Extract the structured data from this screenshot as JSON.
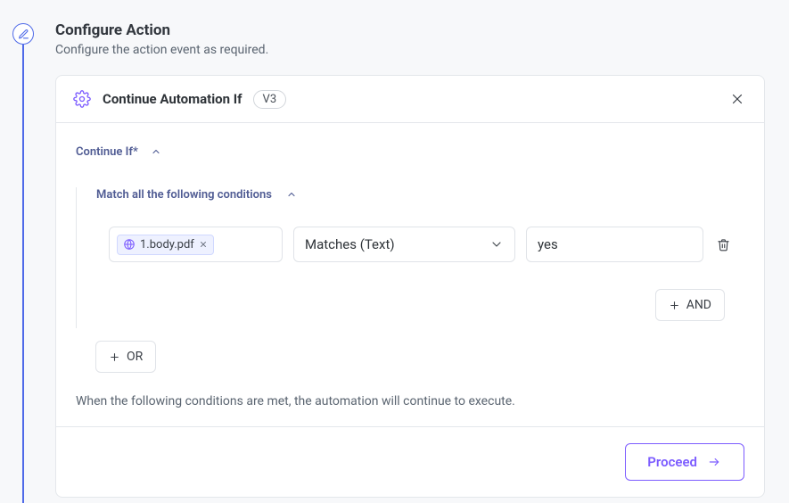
{
  "step": {
    "title": "Configure Action",
    "subtitle": "Configure the action event as required."
  },
  "card": {
    "title": "Continue Automation If",
    "version": "V3"
  },
  "form": {
    "section_label": "Continue If*",
    "match_label": "Match all the following conditions",
    "condition": {
      "token": "1.body.pdf",
      "operator": "Matches (Text)",
      "value": "yes"
    },
    "and_label": "AND",
    "or_label": "OR",
    "helper": "When the following conditions are met, the automation will continue to execute."
  },
  "footer": {
    "proceed_label": "Proceed"
  }
}
